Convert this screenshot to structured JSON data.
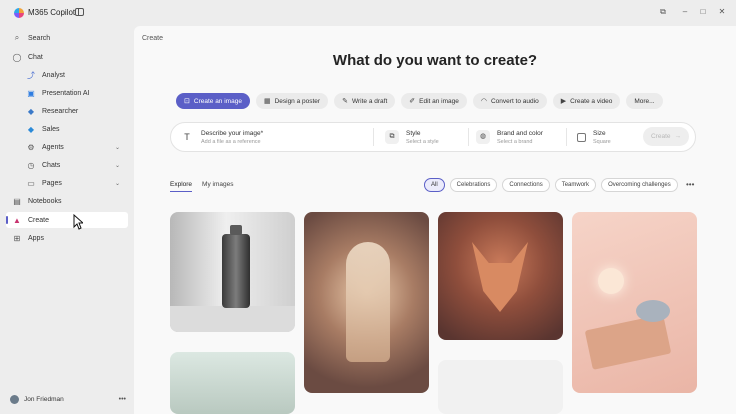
{
  "app": {
    "title": "M365 Copilot"
  },
  "window_controls": {
    "open_icon": "open-in-window-icon",
    "minimize": "–",
    "maximize": "□",
    "close": "✕"
  },
  "sidebar": {
    "items": [
      {
        "label": "Search",
        "icon": "search-icon",
        "glyph": "⌕"
      },
      {
        "label": "Chat",
        "icon": "chat-icon",
        "glyph": "◯"
      },
      {
        "label": "Analyst",
        "icon": "analyst-icon",
        "glyph": "⤴"
      },
      {
        "label": "Presentation AI",
        "icon": "presentation-ai-icon",
        "glyph": "▣"
      },
      {
        "label": "Researcher",
        "icon": "researcher-icon",
        "glyph": "◆"
      },
      {
        "label": "Sales",
        "icon": "sales-icon",
        "glyph": "◆"
      },
      {
        "label": "Agents",
        "icon": "agents-icon",
        "glyph": "⚙"
      },
      {
        "label": "Chats",
        "icon": "chats-icon",
        "glyph": "◷"
      },
      {
        "label": "Pages",
        "icon": "pages-icon",
        "glyph": "▭"
      },
      {
        "label": "Notebooks",
        "icon": "notebooks-icon",
        "glyph": "▤"
      },
      {
        "label": "Create",
        "icon": "create-icon",
        "glyph": "▲"
      },
      {
        "label": "Apps",
        "icon": "apps-icon",
        "glyph": "⊞"
      }
    ],
    "user": {
      "name": "Jon Friedman",
      "more": "•••"
    }
  },
  "main": {
    "breadcrumb": "Create",
    "title": "What do you want to create?",
    "chips": [
      {
        "label": "Create an image",
        "icon": "image-icon",
        "glyph": "⊡"
      },
      {
        "label": "Design a poster",
        "icon": "poster-icon",
        "glyph": "▦"
      },
      {
        "label": "Write a draft",
        "icon": "pen-icon",
        "glyph": "✎"
      },
      {
        "label": "Edit an image",
        "icon": "edit-image-icon",
        "glyph": "✐"
      },
      {
        "label": "Convert to audio",
        "icon": "headphones-icon",
        "glyph": "◠"
      },
      {
        "label": "Create a video",
        "icon": "video-icon",
        "glyph": "▶"
      },
      {
        "label": "More...",
        "icon": "",
        "glyph": ""
      }
    ],
    "prompt": {
      "describe_title": "Describe your image*",
      "describe_sub": "Add a file as a reference",
      "style_title": "Style",
      "style_sub": "Select a style",
      "brand_title": "Brand and color",
      "brand_sub": "Select a brand",
      "size_title": "Size",
      "size_sub": "Square",
      "create_label": "Create",
      "create_arrow": "→"
    },
    "tabs": [
      "Explore",
      "My images"
    ],
    "filters": [
      "All",
      "Celebrations",
      "Connections",
      "Teamwork",
      "Overcoming challenges"
    ],
    "filters_more": "•••"
  },
  "colors": {
    "accent": "#5b5fc7",
    "background": "#ededed",
    "panel": "#f9f9f9"
  }
}
